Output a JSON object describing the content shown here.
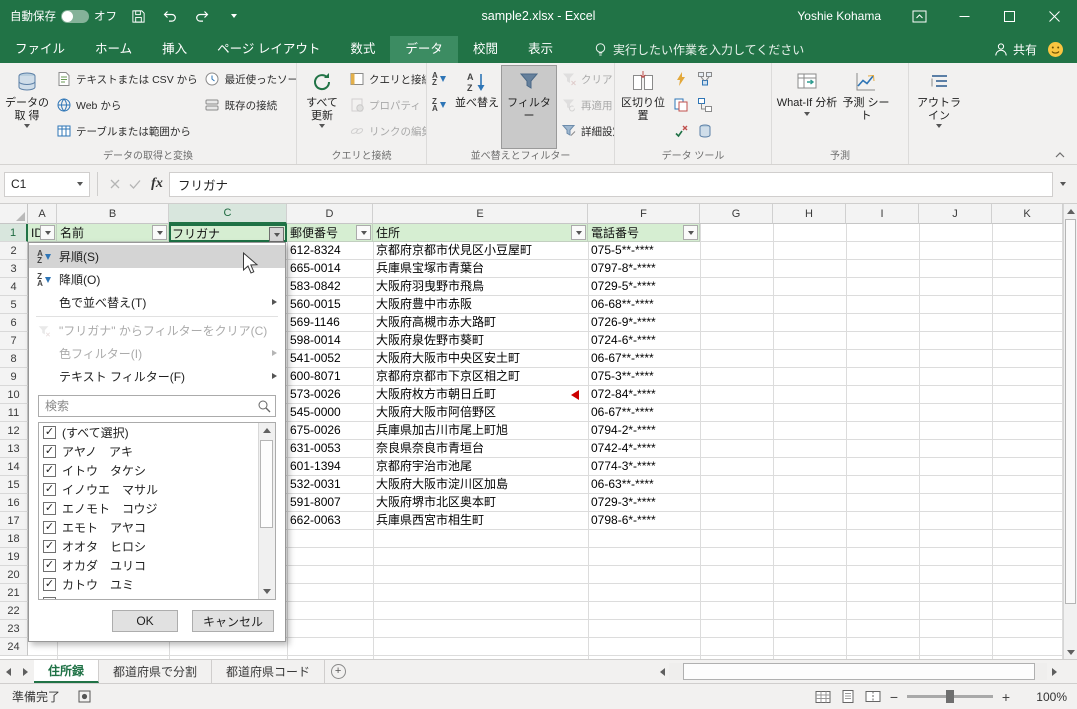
{
  "colors": {
    "excel_green": "#217346",
    "active_tab_green": "#3c8c62",
    "header_fill_green": "#d6eed2",
    "selection_green": "#1e7145"
  },
  "glyphs": {
    "check": "✓",
    "plus": "+",
    "zoom_out": "−",
    "zoom_in": "+",
    "sort_a": "A",
    "sort_z": "Z"
  },
  "titlebar": {
    "autosave_label": "自動保存",
    "autosave_state": "オフ",
    "title": "sample2.xlsx -  Excel",
    "user": "Yoshie Kohama"
  },
  "ribbon_tabs": {
    "file": "ファイル",
    "home": "ホーム",
    "insert": "挿入",
    "page_layout": "ページ レイアウト",
    "formulas": "数式",
    "data": "データ",
    "review": "校閲",
    "view": "表示",
    "tell_me": "実行したい作業を入力してください",
    "share": "共有"
  },
  "ribbon": {
    "get_data": "データの取 得",
    "from_text_csv": "テキストまたは CSV から",
    "from_web": "Web から",
    "from_table_range": "テーブルまたは範囲から",
    "recent_sources": "最近使ったソース",
    "existing_connections": "既存の接続",
    "group_get_transform": "データの取得と変換",
    "refresh_all": "すべて 更新",
    "queries_connections": "クエリと接続",
    "properties": "プロパティ",
    "edit_links": "リンクの編集",
    "group_queries": "クエリと接続",
    "sort_label": "並べ替え",
    "filter_label": "フィルター",
    "clear_label": "クリア",
    "reapply_label": "再適用",
    "advanced_label": "詳細設定",
    "group_sort_filter": "並べ替えとフィルター",
    "text_to_columns": "区切り位置",
    "group_data_tools": "データ ツール",
    "what_if": "What-If 分析",
    "forecast_sheet": "予測 シート",
    "group_forecast": "予測",
    "outline": "アウトライン"
  },
  "formula_bar": {
    "name_box": "C1",
    "fx_label": "fx",
    "content": "フリガナ"
  },
  "grid": {
    "columns": [
      "A",
      "B",
      "C",
      "D",
      "E",
      "F",
      "G",
      "H",
      "I",
      "J",
      "K"
    ],
    "row_numbers": [
      "1",
      "2",
      "3",
      "4",
      "5",
      "6",
      "7",
      "8",
      "9",
      "10",
      "11",
      "12",
      "13",
      "14",
      "15",
      "16",
      "17",
      "18",
      "19",
      "20",
      "21",
      "22",
      "23",
      "24"
    ],
    "header_row": {
      "id": "ID",
      "name": "名前",
      "furigana": "フリガナ",
      "postal": "郵便番号",
      "address": "住所",
      "phone": "電話番号"
    },
    "rows": [
      {
        "postal": "612-8324",
        "address": "京都府京都市伏見区小豆屋町",
        "phone": "075-5**-****"
      },
      {
        "postal": "665-0014",
        "address": "兵庫県宝塚市青葉台",
        "phone": "0797-8*-****"
      },
      {
        "postal": "583-0842",
        "address": "大阪府羽曳野市飛鳥",
        "phone": "0729-5*-****"
      },
      {
        "postal": "560-0015",
        "address": "大阪府豊中市赤阪",
        "phone": "06-68**-****"
      },
      {
        "postal": "569-1146",
        "address": "大阪府高槻市赤大路町",
        "phone": "0726-9*-****"
      },
      {
        "postal": "598-0014",
        "address": "大阪府泉佐野市葵町",
        "phone": "0724-6*-****"
      },
      {
        "postal": "541-0052",
        "address": "大阪府大阪市中央区安土町",
        "phone": "06-67**-****"
      },
      {
        "postal": "600-8071",
        "address": "京都府京都市下京区相之町",
        "phone": "075-3**-****"
      },
      {
        "postal": "573-0026",
        "address": "大阪府枚方市朝日丘町",
        "phone": "072-84*-****"
      },
      {
        "postal": "545-0000",
        "address": "大阪府大阪市阿倍野区",
        "phone": "06-67**-****"
      },
      {
        "postal": "675-0026",
        "address": "兵庫県加古川市尾上町旭",
        "phone": "0794-2*-****"
      },
      {
        "postal": "631-0053",
        "address": "奈良県奈良市青垣台",
        "phone": "0742-4*-****"
      },
      {
        "postal": "601-1394",
        "address": "京都府宇治市池尾",
        "phone": "0774-3*-****"
      },
      {
        "postal": "532-0031",
        "address": "大阪府大阪市淀川区加島",
        "phone": "06-63**-****"
      },
      {
        "postal": "591-8007",
        "address": "大阪府堺市北区奥本町",
        "phone": "0729-3*-****"
      },
      {
        "postal": "662-0063",
        "address": "兵庫県西宮市相生町",
        "phone": "0798-6*-****"
      }
    ]
  },
  "filter_menu": {
    "sort_asc": "昇順(S)",
    "sort_desc": "降順(O)",
    "sort_by_color": "色で並べ替え(T)",
    "clear_filter": "\"フリガナ\" からフィルターをクリア(C)",
    "color_filter": "色フィルター(I)",
    "text_filters": "テキスト フィルター(F)",
    "search_placeholder": "検索",
    "items": [
      "(すべて選択)",
      "アヤノ　アキ",
      "イトウ　タケシ",
      "イノウエ　マサル",
      "エノモト　コウジ",
      "エモト　アヤコ",
      "オオタ　ヒロシ",
      "オカダ　ユリコ",
      "カトウ　ユミ"
    ],
    "ok": "OK",
    "cancel": "キャンセル"
  },
  "sheet_tabs": {
    "items": [
      "住所録",
      "都道府県で分割",
      "都道府県コード"
    ],
    "active": "住所録"
  },
  "status_bar": {
    "ready": "準備完了",
    "zoom_level": "100%"
  }
}
